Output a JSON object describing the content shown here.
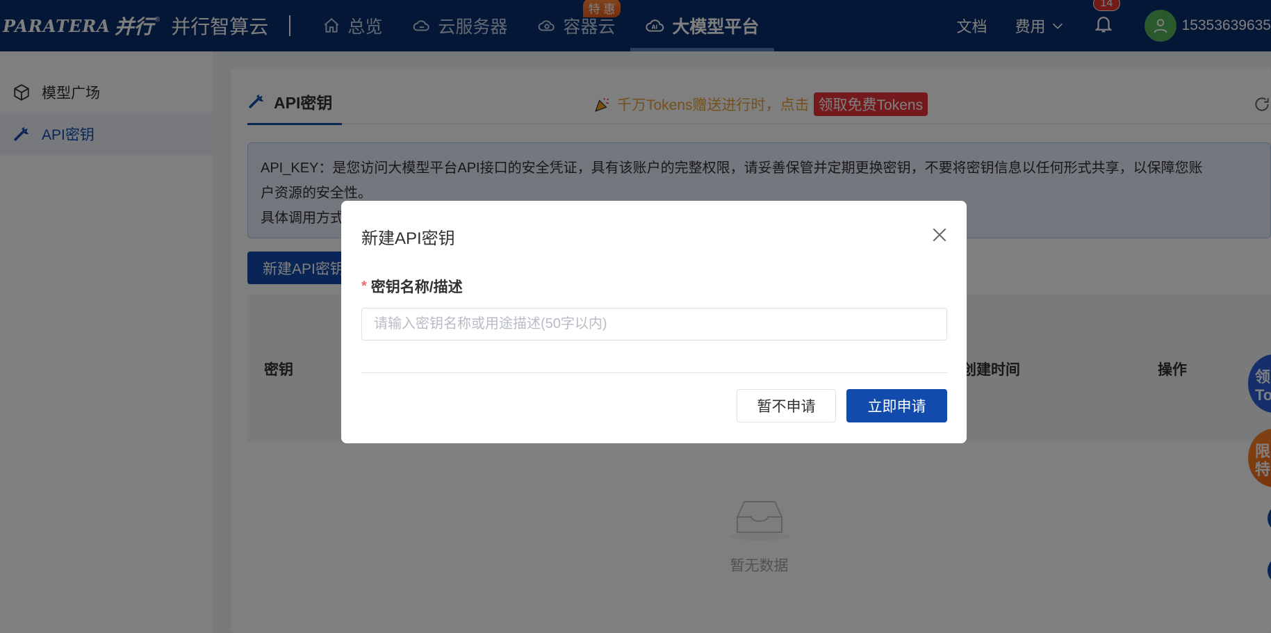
{
  "brand": {
    "logo_text": "PARATERA",
    "logo_cn": "并行",
    "logo_mark": "®",
    "title": "并行智算云"
  },
  "nav": {
    "items": [
      {
        "label": "总览",
        "icon": "home-icon"
      },
      {
        "label": "云服务器",
        "icon": "cloud-server-icon"
      },
      {
        "label": "容器云",
        "icon": "container-cloud-icon",
        "badge": "特 惠"
      },
      {
        "label": "大模型平台",
        "icon": "ai-cloud-icon",
        "active": true
      }
    ]
  },
  "topright": {
    "docs": "文档",
    "fees": "费用",
    "notifications_count": "14",
    "user_id": "15353639635"
  },
  "sidebar": {
    "items": [
      {
        "label": "模型广场",
        "icon": "cube-icon"
      },
      {
        "label": "API密钥",
        "icon": "wrench-icon",
        "active": true
      }
    ]
  },
  "main": {
    "tab_title": "API密钥",
    "promo_text": "千万Tokens赠送进行时，点击",
    "promo_link": "领取免费Tokens",
    "notice_line1": "API_KEY：是您访问大模型平台API接口的安全凭证，具有该账户的完整权限，请妥善保管并定期更换密钥，不要将密钥信息以任何形式共享，以保障您账",
    "notice_line2": "户资源的安全性。",
    "notice_line3": "具体调用方式",
    "new_button": "新建API密钥",
    "table_headers": [
      "密钥",
      "创建时间",
      "操作"
    ],
    "empty_text": "暂无数据"
  },
  "float": {
    "btn1_line1": "领",
    "btn1_line2": "To",
    "btn2_line1": "限",
    "btn2_line2": "特"
  },
  "dialog": {
    "title": "新建API密钥",
    "required_mark": "*",
    "field_label": "密钥名称/描述",
    "field_placeholder": "请输入密钥名称或用途描述(50字以内)",
    "field_value": "",
    "cancel_label": "暂不申请",
    "ok_label": "立即申请"
  },
  "colors": {
    "topbar": "#0a2f6c",
    "primary": "#114bab",
    "promo_orange": "#e6a23c",
    "promo_red": "#e9353a"
  }
}
